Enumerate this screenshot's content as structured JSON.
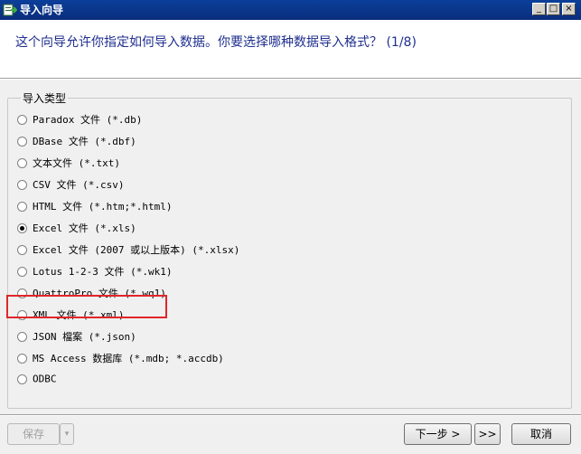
{
  "window": {
    "title": "导入向导",
    "min_label": "_",
    "max_label": "□",
    "close_label": "×"
  },
  "header": {
    "text": "这个向导允许你指定如何导入数据。你要选择哪种数据导入格式？ (1/8)"
  },
  "group": {
    "legend": "导入类型",
    "options": [
      {
        "label": "Paradox 文件 (*.db)",
        "checked": false
      },
      {
        "label": "DBase 文件 (*.dbf)",
        "checked": false
      },
      {
        "label": "文本文件 (*.txt)",
        "checked": false
      },
      {
        "label": "CSV 文件 (*.csv)",
        "checked": false
      },
      {
        "label": "HTML 文件 (*.htm;*.html)",
        "checked": false
      },
      {
        "label": "Excel 文件 (*.xls)",
        "checked": true
      },
      {
        "label": "Excel 文件 (2007 或以上版本) (*.xlsx)",
        "checked": false
      },
      {
        "label": "Lotus 1-2-3 文件 (*.wk1)",
        "checked": false
      },
      {
        "label": "QuattroPro 文件 (*.wq1)",
        "checked": false
      },
      {
        "label": "XML 文件 (*.xml)",
        "checked": false
      },
      {
        "label": "JSON 檔案 (*.json)",
        "checked": false
      },
      {
        "label": "MS Access 数据库 (*.mdb; *.accdb)",
        "checked": false
      },
      {
        "label": "ODBC",
        "checked": false
      }
    ]
  },
  "footer": {
    "save_label": "保存",
    "save_dropdown": "▾",
    "next_label": "下一步 >",
    "last_label": ">>",
    "cancel_label": "取消"
  },
  "colors": {
    "titlebar": "#0a2d7c",
    "header_text": "#1f2f8f",
    "highlight": "#e0262b"
  }
}
